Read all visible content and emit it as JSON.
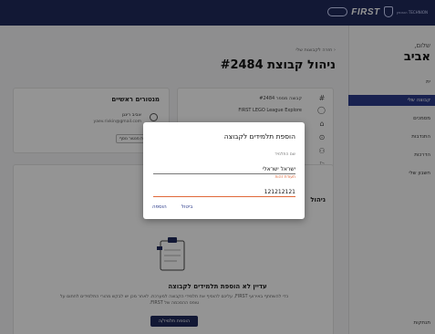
{
  "brand": {
    "name": "FIRST",
    "tech_label": "הטכניון TECHNION"
  },
  "sidebar": {
    "greeting": "שלום,",
    "user_name": "אביב",
    "items": [
      {
        "label": "ית",
        "active": false
      },
      {
        "label": "קבוצה שלי",
        "active": true
      },
      {
        "label": "מסמכים",
        "active": false
      },
      {
        "label": "התנדבות",
        "active": false
      },
      {
        "label": "הדרכות",
        "active": false
      },
      {
        "label": "חשבון שלי",
        "active": false
      }
    ],
    "bottom": "תנתקות"
  },
  "page": {
    "breadcrumb": "חזרה לקבוצות שלי",
    "title": "ניהול קבוצת #2484"
  },
  "details": {
    "rows": [
      {
        "icon": "#",
        "text": "קבוצה מספר #2484"
      },
      {
        "icon": "◯",
        "text": "FIRST LEGO League Explore"
      },
      {
        "icon": "⌂",
        "text": ""
      },
      {
        "icon": "⊙",
        "text": ""
      },
      {
        "icon": "⚇",
        "text": ""
      },
      {
        "icon": "⚐",
        "text": ""
      }
    ]
  },
  "mentors": {
    "title": "מנטורים ראשיים",
    "name": "אביב רינגן",
    "email": "yaev.rivkin@gmail.com",
    "add_label": "הוספת מנטור נוסף"
  },
  "students": {
    "title": "ניהול",
    "empty_title": "עדיין לא הוספת תלמידים לקבוצה",
    "empty_desc": "כדי להשתתף באירועי FIRST, עליכם להוסיף את תלמידי הקבוצה למערכת. לאחר מכן יש לבקש מהורי התלמידים לחתום על טופס ההסכמה של FIRST.",
    "add_button": "הוספת תלמיד/ה"
  },
  "modal": {
    "title": "הוספת תלמידים לקבוצה",
    "name_label": "שם התלמיד",
    "name_value": "ישראל ישראלי",
    "id_label": "תעודת זהות",
    "id_value": "121212121",
    "cancel_label": "ביטול",
    "add_label": "הוספה"
  }
}
